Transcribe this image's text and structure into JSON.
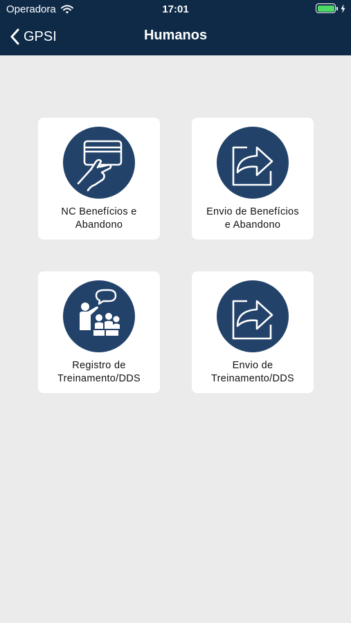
{
  "status_bar": {
    "carrier": "Operadora",
    "time": "17:01",
    "wifi_icon": "wifi-icon",
    "battery_icon": "battery-full-icon",
    "charging_icon": "bolt-icon"
  },
  "nav": {
    "back_label": "GPSI",
    "title": "Humanos",
    "back_icon": "chevron-left-icon"
  },
  "colors": {
    "header": "#0e2a47",
    "tile_circle": "#22426a",
    "background": "#ebebeb",
    "battery": "#4cd964"
  },
  "tiles": [
    {
      "line1": "NC Benefícios e",
      "line2": "Abandono",
      "icon": "card-hand-icon"
    },
    {
      "line1": "Envio de Benefícios",
      "line2": "e Abandono",
      "icon": "share-arrow-icon"
    },
    {
      "line1": "Registro de",
      "line2": "Treinamento/DDS",
      "icon": "training-presentation-icon"
    },
    {
      "line1": "Envio de",
      "line2": "Treinamento/DDS",
      "icon": "share-arrow-icon"
    }
  ]
}
